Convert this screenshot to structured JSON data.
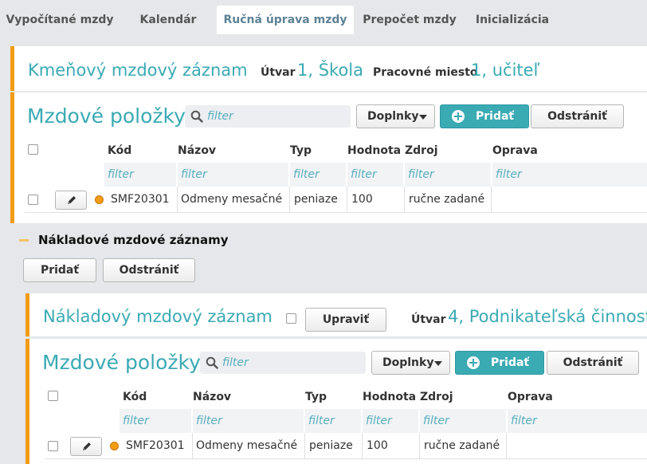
{
  "tabs": [
    {
      "label": "Vypočítané mzdy"
    },
    {
      "label": "Kalendár"
    },
    {
      "label": "Ručná úprava mzdy"
    },
    {
      "label": "Prepočet mzdy"
    },
    {
      "label": "Inicializácia"
    }
  ],
  "main_record": {
    "title": "Kmeňový mzdový záznam",
    "unit_label": "Útvar",
    "unit_value": "1, Škola",
    "position_label": "Pracovné miesto",
    "position_value": "1, učiteľ"
  },
  "items_1": {
    "title": "Mzdové položky",
    "search_placeholder": "filter",
    "addons_label": "Doplnky",
    "add_label": "Pridať",
    "remove_label": "Odstrániť",
    "columns": {
      "code": "Kód",
      "name": "Názov",
      "type": "Typ",
      "value": "Hodnota",
      "source": "Zdroj",
      "fix": "Oprava"
    },
    "filter_placeholder": "filter",
    "rows": [
      {
        "code": "SMF20301",
        "name": "Odmeny mesačné",
        "type": "peniaze",
        "value": "100",
        "source": "ručne zadané",
        "fix": ""
      }
    ]
  },
  "cost_section": {
    "title": "Nákladové mzdové záznamy",
    "add_label": "Pridať",
    "remove_label": "Odstrániť"
  },
  "cost_record": {
    "title": "Nákladový mzdový záznam",
    "edit_label": "Upraviť",
    "unit_label": "Útvar",
    "unit_value": "4, Podnikateľská činnosť"
  },
  "items_2": {
    "title": "Mzdové položky",
    "search_placeholder": "filter",
    "addons_label": "Doplnky",
    "add_label": "Pridať",
    "remove_label": "Odstrániť",
    "columns": {
      "code": "Kód",
      "name": "Názov",
      "type": "Typ",
      "value": "Hodnota",
      "source": "Zdroj",
      "fix": "Oprava"
    },
    "filter_placeholder": "filter",
    "rows": [
      {
        "code": "SMF20301",
        "name": "Odmeny mesačné",
        "type": "peniaze",
        "value": "100",
        "source": "ručne zadané",
        "fix": ""
      }
    ]
  },
  "colors": {
    "accent": "#3aaab3",
    "marker": "#f39c12",
    "background": "#e5e7ea"
  },
  "icons": {
    "search": "search-icon",
    "edit": "pencil-icon",
    "add": "plus-circle-icon",
    "dropdown": "caret-down-icon",
    "collapse": "collapse-icon",
    "status": "status-dot-icon"
  }
}
